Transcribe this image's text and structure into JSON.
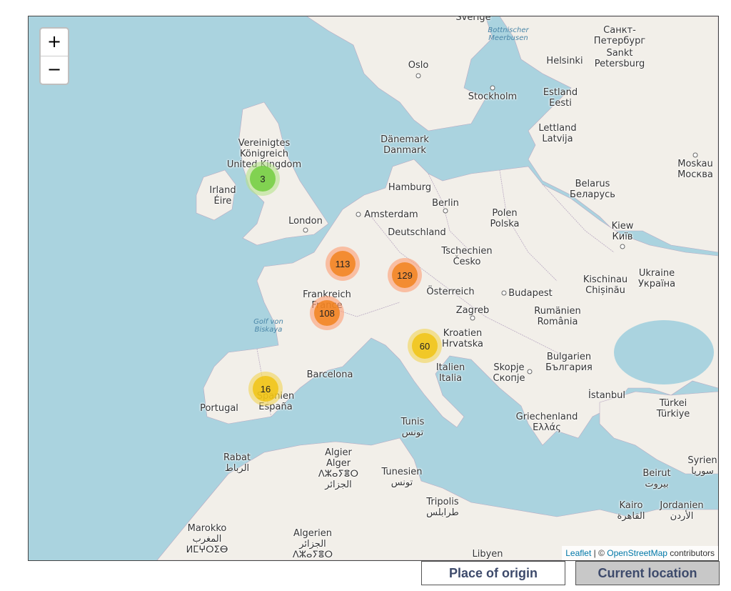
{
  "map": {
    "zoom_in_label": "+",
    "zoom_out_label": "−",
    "attribution": {
      "leaflet": "Leaflet",
      "separator": " | © ",
      "osm": "OpenStreetMap",
      "contributors": " contributors"
    },
    "place_labels": {
      "sverige": "Sverige",
      "bottnischer": "Bottnischer\nMeerbusen",
      "sankt_pet_ru": "Санкт-\nПетербург",
      "sankt_pet": "Sankt\nPetersburg",
      "oslo": "Oslo",
      "helsinki": "Helsinki",
      "stockholm": "Stockholm",
      "estland": "Estland\nEesti",
      "lettland": "Lettland\nLatvija",
      "vereinigtes": "Vereinigtes\nKönigreich\nUnited Kingdom",
      "danemark": "Dänemark\nDanmark",
      "moskau": "Moskau\nМосква",
      "irland": "Irland\nÉire",
      "hamburg": "Hamburg",
      "berlin": "Berlin",
      "belarus": "Belarus\nБеларусь",
      "amsterdam": "Amsterdam",
      "london": "London",
      "polen": "Polen\nPolska",
      "deutschland": "Deutschland",
      "kiew": "Kiew\nКиїв",
      "tschechien": "Tschechien\nČesko",
      "kischinau": "Kischinau\nChișinău",
      "ukraine": "Ukraine\nУкраїна",
      "frankreich": "Frankreich\nFrance",
      "osterreich": "Österreich",
      "budapest": "Budapest",
      "zagreb": "Zagreb",
      "rumanien": "Rumänien\nRomânia",
      "golf": "Golf von\nBiskaya",
      "kroatien": "Kroatien\nHrvatska",
      "bulgarien": "Bulgarien\nБългария",
      "barcelona": "Barcelona",
      "italien": "Italien\nItalia",
      "skopje": "Skopje\nСкопје",
      "istanbul": "İstanbul",
      "portugal": "Portugal",
      "spanien": "Spanien\nEspaña",
      "turkei": "Türkei\nTürkiye",
      "griechenland": "Griechenland\nΕλλάς",
      "tunis": "Tunis\nتونس",
      "rabat": "Rabat\nالرباط",
      "algier": "Algier\nAlger\nⴷⵣⴰⵢⴻⵔ\nالجزائر",
      "tunesien": "Tunesien\nتونس",
      "syrien": "Syrien\nسوريا",
      "beirut": "Beirut\nبيروت",
      "tripolis": "Tripolis\nطرابلس",
      "kairo": "Kairo\nالقاهرة",
      "jordanien": "Jordanien\nالأردن",
      "marokko": "Marokko\nالمغرب\nⵍⵎⵖⵔⵉⴱ",
      "algerien": "Algerien\nالجزائر\nⴷⵣⴰⵢⴻⵔ",
      "libyen": "Libyen"
    },
    "clusters": [
      {
        "id": "uk",
        "count": "3",
        "level": "small"
      },
      {
        "id": "paris",
        "count": "113",
        "level": "large"
      },
      {
        "id": "munich",
        "count": "129",
        "level": "large"
      },
      {
        "id": "france-center",
        "count": "108",
        "level": "large"
      },
      {
        "id": "italy",
        "count": "60",
        "level": "medium"
      },
      {
        "id": "spain",
        "count": "16",
        "level": "medium"
      }
    ]
  },
  "toggle": {
    "origin_label": "Place of origin",
    "current_label": "Current location"
  },
  "colors": {
    "sea": "#aad3df",
    "land": "#f2efe9",
    "cluster_small": "#6ecc39",
    "cluster_medium": "#f0c20c",
    "cluster_large": "#f18017"
  }
}
